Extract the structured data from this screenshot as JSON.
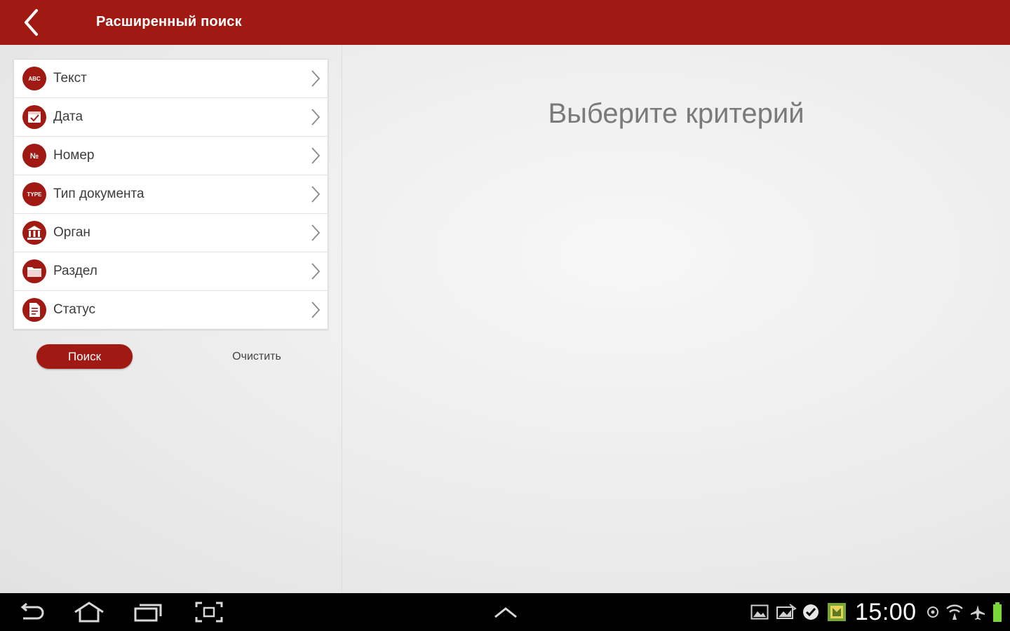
{
  "appbar": {
    "title": "Расширенный поиск",
    "back_icon": "back-arrow-icon",
    "accent_color": "#a01a13"
  },
  "criteria": [
    {
      "label": "Текст",
      "icon": "abc-icon"
    },
    {
      "label": "Дата",
      "icon": "calendar-icon"
    },
    {
      "label": "Номер",
      "icon": "number-icon"
    },
    {
      "label": "Тип документа",
      "icon": "type-icon"
    },
    {
      "label": "Орган",
      "icon": "institution-icon"
    },
    {
      "label": "Раздел",
      "icon": "folder-icon"
    },
    {
      "label": "Статус",
      "icon": "document-status-icon"
    }
  ],
  "actions": {
    "search_label": "Поиск",
    "clear_label": "Очистить"
  },
  "detail": {
    "placeholder": "Выберите критерий"
  },
  "system_bar": {
    "time": "15:00"
  }
}
